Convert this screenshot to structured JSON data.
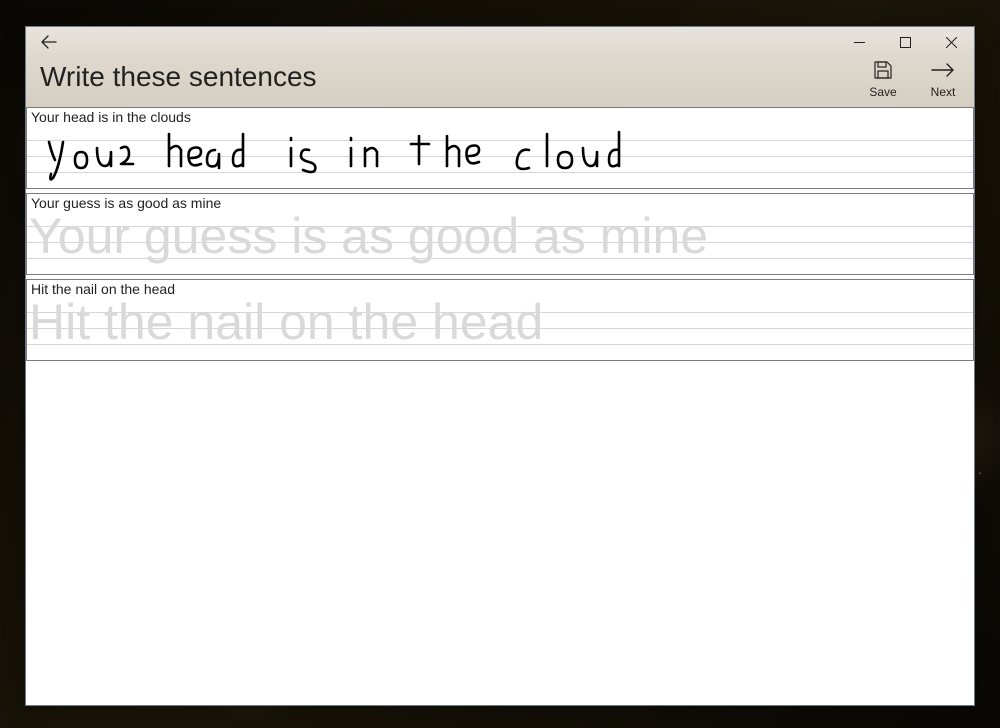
{
  "header": {
    "title": "Write these sentences"
  },
  "toolbar": {
    "save_label": "Save",
    "next_label": "Next"
  },
  "sentences": [
    {
      "prompt": "Your head is in the clouds",
      "guide": "",
      "handwriting": "your head is in the cloud"
    },
    {
      "prompt": "Your guess is as good as mine",
      "guide": "Your guess is as good as mine",
      "handwriting": ""
    },
    {
      "prompt": "Hit the nail on the head",
      "guide": "Hit the nail on the head",
      "handwriting": ""
    }
  ]
}
